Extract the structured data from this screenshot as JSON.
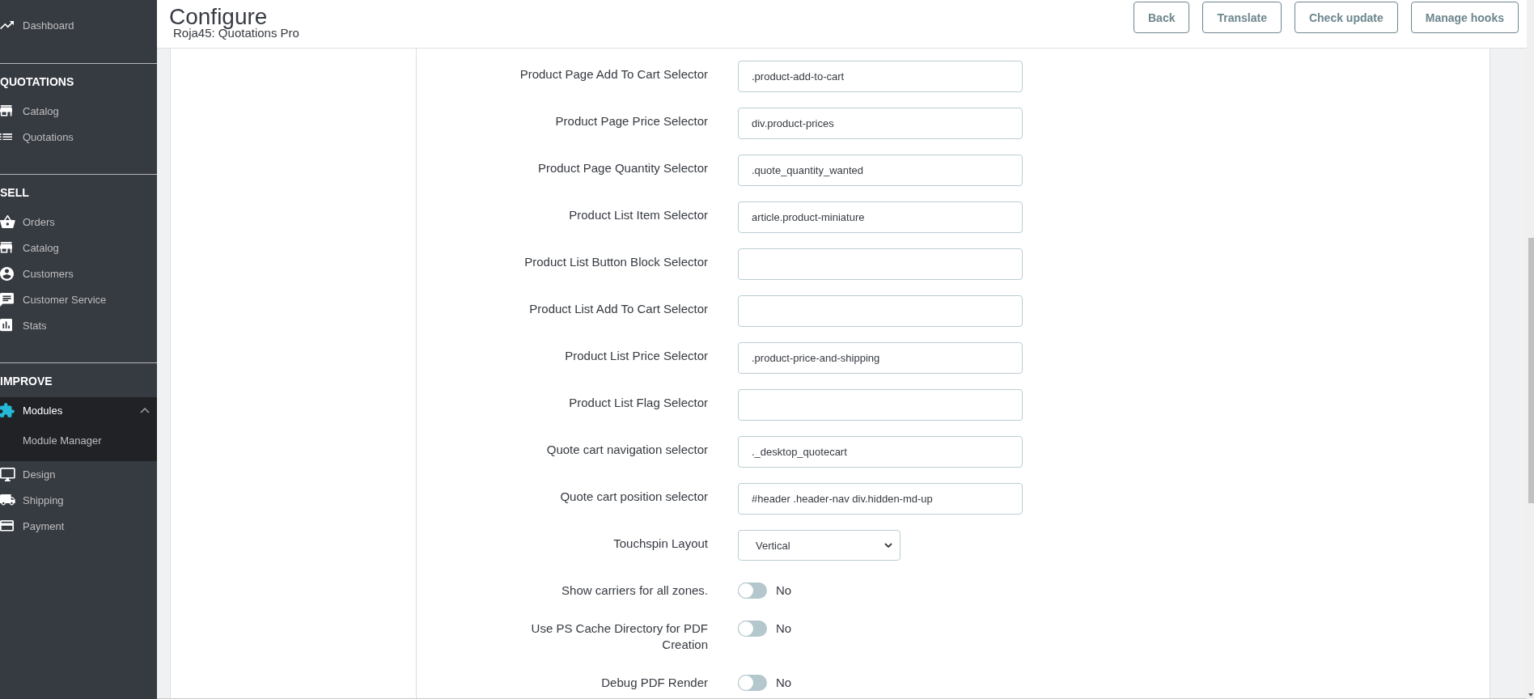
{
  "sidebar": {
    "sections": [
      {
        "items": [
          {
            "label": "Dashboard",
            "selected": false
          }
        ]
      },
      {
        "title": "QUOTATIONS",
        "items": [
          {
            "label": "Catalog",
            "selected": false
          },
          {
            "label": "Quotations",
            "selected": false
          }
        ]
      },
      {
        "title": "SELL",
        "items": [
          {
            "label": "Orders",
            "selected": false
          },
          {
            "label": "Catalog",
            "selected": false
          },
          {
            "label": "Customers",
            "selected": false
          },
          {
            "label": "Customer Service",
            "selected": false
          },
          {
            "label": "Stats",
            "selected": false
          }
        ]
      },
      {
        "title": "IMPROVE",
        "items": [
          {
            "label": "Modules",
            "selected": true,
            "expanded": true,
            "children": [
              {
                "label": "Module Manager",
                "selected": false
              }
            ]
          },
          {
            "label": "Design",
            "selected": false
          },
          {
            "label": "Shipping",
            "selected": false
          },
          {
            "label": "Payment",
            "selected": false
          }
        ]
      }
    ]
  },
  "header": {
    "title": "Configure",
    "subtitle": "Roja45: Quotations Pro",
    "buttons": [
      "Back",
      "Translate",
      "Check update",
      "Manage hooks"
    ]
  },
  "form": {
    "fields": [
      {
        "kind": "text",
        "label": "Product Page Add To Cart Selector",
        "value": ".product-add-to-cart"
      },
      {
        "kind": "text",
        "label": "Product Page Price Selector",
        "value": "div.product-prices"
      },
      {
        "kind": "text",
        "label": "Product Page Quantity Selector",
        "value": ".quote_quantity_wanted"
      },
      {
        "kind": "text",
        "label": "Product List Item Selector",
        "value": "article.product-miniature"
      },
      {
        "kind": "text",
        "label": "Product List Button Block Selector"
      },
      {
        "kind": "text",
        "label": "Product List Add To Cart Selector"
      },
      {
        "kind": "text",
        "label": "Product List Price Selector",
        "value": ".product-price-and-shipping"
      },
      {
        "kind": "text",
        "label": "Product List Flag Selector"
      },
      {
        "kind": "text",
        "label": "Quote cart navigation selector",
        "value": "._desktop_quotecart"
      },
      {
        "kind": "text",
        "label": "Quote cart position selector",
        "value": "#header .header-nav div.hidden-md-up"
      },
      {
        "kind": "select",
        "label": "Touchspin Layout",
        "value": "Vertical"
      },
      {
        "kind": "switch",
        "label": "Show carriers for all zones.",
        "on": false,
        "state_label": "No"
      },
      {
        "kind": "switch",
        "label": "Use PS Cache Directory for PDF Creation",
        "on": false,
        "state_label": "No"
      },
      {
        "kind": "switch",
        "label": "Debug PDF Render",
        "on": false,
        "state_label": "No"
      }
    ]
  }
}
